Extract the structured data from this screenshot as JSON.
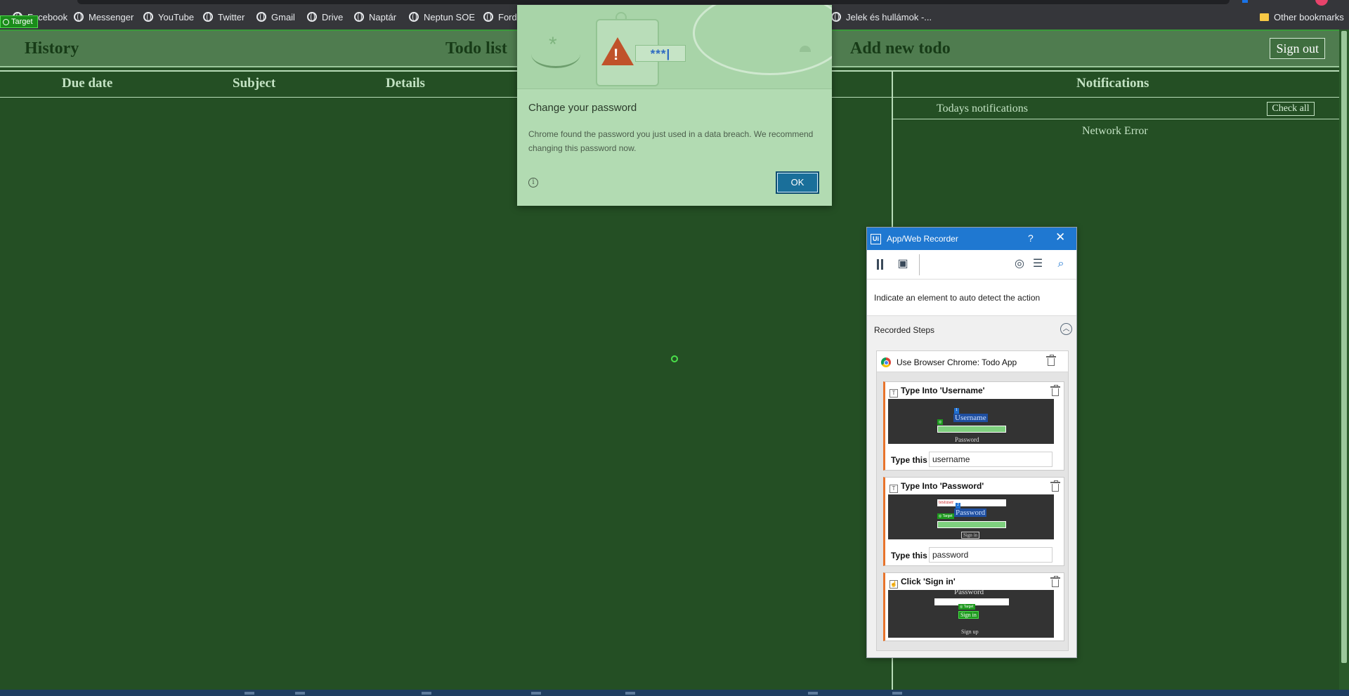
{
  "bookmarks": {
    "items": [
      "Facebook",
      "Messenger",
      "YouTube",
      "Twitter",
      "Gmail",
      "Drive",
      "Naptár",
      "Neptun SOE",
      "Ford",
      "Jelek és hullámok -..."
    ],
    "other": "Other bookmarks",
    "target_badge": "Target"
  },
  "app": {
    "nav": {
      "history": "History",
      "todo_list": "Todo list",
      "add_new": "Add new todo",
      "sign_out": "Sign out"
    },
    "columns": {
      "due_date": "Due date",
      "subject": "Subject",
      "details": "Details"
    },
    "notifications": {
      "title": "Notifications",
      "todays": "Todays notifications",
      "check_all": "Check all",
      "error": "Network Error"
    }
  },
  "password_popup": {
    "title": "Change your password",
    "body": "Chrome found the password you just used in a data breach. We recommend changing this password now.",
    "ok": "OK",
    "illustration_text": "***|"
  },
  "recorder": {
    "title": "App/Web Recorder",
    "help": "?",
    "indicate": "Indicate an element to auto detect the action",
    "recorded_steps": "Recorded Steps",
    "scope": "Use Browser Chrome: Todo App",
    "steps": [
      {
        "title": "Type Into 'Username'",
        "type_label": "Type this",
        "value": "username",
        "shot_label": "Username",
        "shot_caption": "Password"
      },
      {
        "title": "Type Into 'Password'",
        "type_label": "Type this",
        "value": "password",
        "shot_label": "Password",
        "shot_top": "testuser",
        "shot_caption": "Sign in"
      },
      {
        "title": "Click 'Sign in'",
        "shot_top": "Password",
        "shot_label": "Sign in",
        "shot_caption": "Sign up"
      }
    ]
  },
  "colors": {
    "app_bg": "#244f24",
    "navbar": "#4f7c4f",
    "popup_bg": "#b2dbb2",
    "recorder_title": "#1f78d1",
    "step_accent": "#e8742c"
  }
}
